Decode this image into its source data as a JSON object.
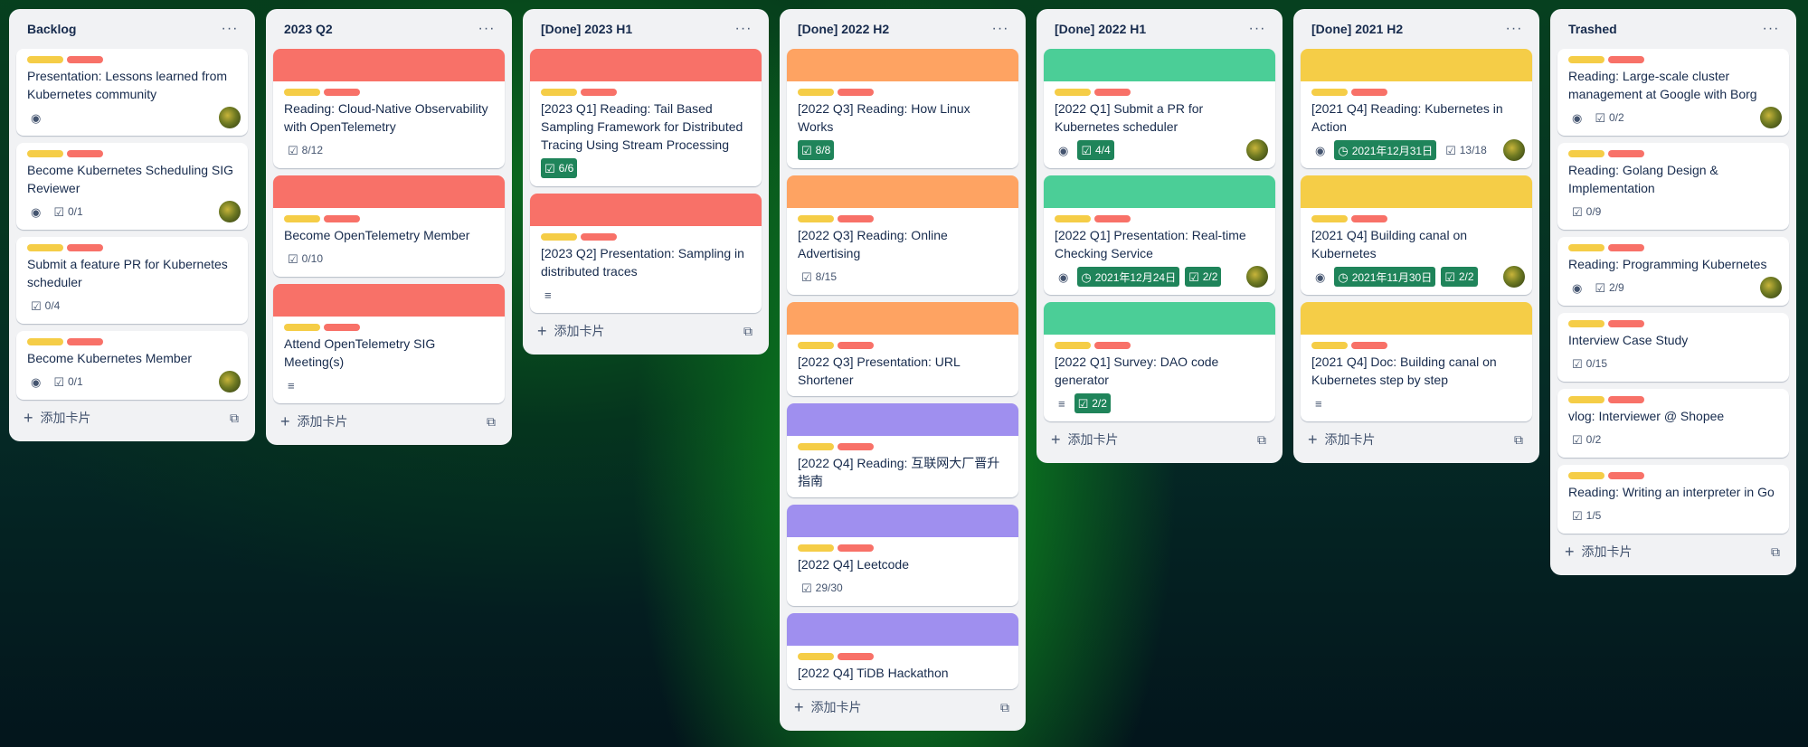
{
  "colors": {
    "yellow_label": "#f5cd47",
    "red_label": "#f87168",
    "red_cover": "#f87168",
    "orange_cover": "#fea362",
    "green_cover": "#4bce97",
    "yellow_cover": "#f5cd47",
    "purple_cover": "#9f8fef",
    "badge_green": "#1f845a"
  },
  "icons": {
    "watch": "eye-icon",
    "checklist": "checklist-icon",
    "description": "description-icon",
    "due": "clock-icon",
    "add": "plus-icon",
    "template": "template-icon",
    "menu": "more-icon"
  },
  "add_card_label": "添加卡片",
  "menu_glyph": "···",
  "lists": [
    {
      "title": "Backlog",
      "cards": [
        {
          "title": "Presentation: Lessons learned from Kubernetes community",
          "watch": true,
          "avatar": true
        },
        {
          "title": "Become Kubernetes Scheduling SIG Reviewer",
          "watch": true,
          "checklist": "0/1",
          "avatar": true
        },
        {
          "title": "Submit a feature PR for Kubernetes scheduler",
          "checklist": "0/4"
        },
        {
          "title": "Become Kubernetes Member",
          "watch": true,
          "checklist": "0/1",
          "avatar": true
        }
      ]
    },
    {
      "title": "2023 Q2",
      "cards": [
        {
          "title": "Reading: Cloud-Native Observability with OpenTelemetry",
          "cover": "red",
          "checklist": "8/12"
        },
        {
          "title": "Become OpenTelemetry Member",
          "cover": "red",
          "checklist": "0/10"
        },
        {
          "title": "Attend OpenTelemetry SIG Meeting(s)",
          "cover": "red",
          "description": true
        }
      ]
    },
    {
      "title": "[Done] 2023 H1",
      "cards": [
        {
          "title": "[2023 Q1] Reading: Tail Based Sampling Framework for Distributed Tracing Using Stream Processing",
          "cover": "red",
          "checklist": "6/6",
          "checklist_done": true
        },
        {
          "title": "[2023 Q2] Presentation: Sampling in distributed traces",
          "cover": "red",
          "description": true
        }
      ]
    },
    {
      "title": "[Done] 2022 H2",
      "cards": [
        {
          "title": "[2022 Q3] Reading: How Linux Works",
          "cover": "orange",
          "checklist": "8/8",
          "checklist_done": true
        },
        {
          "title": "[2022 Q3] Reading: Online Advertising",
          "cover": "orange",
          "checklist": "8/15"
        },
        {
          "title": "[2022 Q3] Presentation: URL Shortener",
          "cover": "orange"
        },
        {
          "title": "[2022 Q4] Reading: 互联网大厂晋升指南",
          "cover": "purple"
        },
        {
          "title": "[2022 Q4] Leetcode",
          "cover": "purple",
          "checklist": "29/30"
        },
        {
          "title": "[2022 Q4] TiDB Hackathon",
          "cover": "purple"
        }
      ]
    },
    {
      "title": "[Done] 2022 H1",
      "cards": [
        {
          "title": "[2022 Q1] Submit a PR for Kubernetes scheduler",
          "cover": "green",
          "watch": true,
          "checklist": "4/4",
          "checklist_done": true,
          "avatar": true
        },
        {
          "title": "[2022 Q1] Presentation: Real-time Checking Service",
          "cover": "green",
          "watch": true,
          "due": "2021年12月24日",
          "checklist": "2/2",
          "checklist_done": true,
          "avatar": true
        },
        {
          "title": "[2022 Q1] Survey: DAO code generator",
          "cover": "green",
          "description": true,
          "checklist": "2/2",
          "checklist_done": true
        }
      ]
    },
    {
      "title": "[Done] 2021 H2",
      "cards": [
        {
          "title": "[2021 Q4] Reading: Kubernetes in Action",
          "cover": "yellow",
          "watch": true,
          "due": "2021年12月31日",
          "checklist": "13/18",
          "avatar": true
        },
        {
          "title": "[2021 Q4] Building canal on Kubernetes",
          "cover": "yellow",
          "watch": true,
          "due": "2021年11月30日",
          "checklist": "2/2",
          "checklist_done": true,
          "avatar": true
        },
        {
          "title": "[2021 Q4] Doc: Building canal on Kubernetes step by step",
          "cover": "yellow",
          "description": true
        }
      ]
    },
    {
      "title": "Trashed",
      "cards": [
        {
          "title": "Reading: Large-scale cluster management at Google with Borg",
          "watch": true,
          "checklist": "0/2",
          "avatar": true
        },
        {
          "title": "Reading: Golang Design & Implementation",
          "checklist": "0/9"
        },
        {
          "title": "Reading: Programming Kubernetes",
          "watch": true,
          "checklist": "2/9",
          "avatar": true
        },
        {
          "title": "Interview Case Study",
          "checklist": "0/15"
        },
        {
          "title": "vlog: Interviewer @ Shopee",
          "checklist": "0/2"
        },
        {
          "title": "Reading: Writing an interpreter in Go",
          "checklist": "1/5"
        }
      ]
    }
  ]
}
